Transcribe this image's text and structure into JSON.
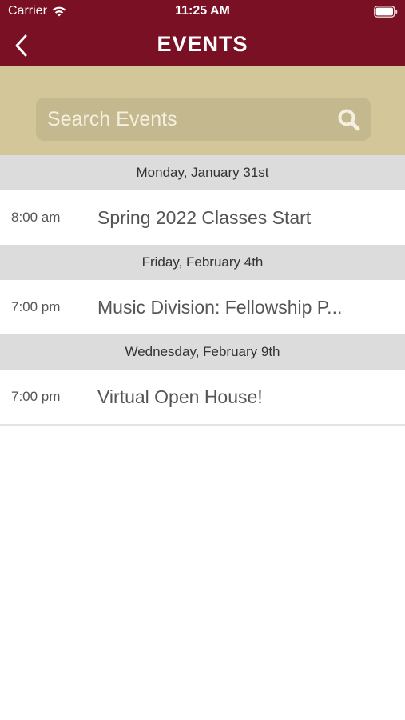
{
  "status_bar": {
    "carrier": "Carrier",
    "time": "11:25 AM"
  },
  "nav": {
    "title": "EVENTS",
    "back_icon": "chevron-left-icon"
  },
  "search": {
    "placeholder": "Search Events",
    "icon": "search-icon"
  },
  "colors": {
    "header_bg": "#7a1023",
    "search_area_bg": "#d3c799",
    "search_box_bg": "#c4b98e",
    "date_header_bg": "#dcdcdc"
  },
  "events": {
    "sections": [
      {
        "date": "Monday, January 31st",
        "items": [
          {
            "time": "8:00 am",
            "title": "Spring 2022 Classes Start"
          }
        ]
      },
      {
        "date": "Friday, February 4th",
        "items": [
          {
            "time": "7:00 pm",
            "title": "Music Division: Fellowship P..."
          }
        ]
      },
      {
        "date": "Wednesday, February 9th",
        "items": [
          {
            "time": "7:00 pm",
            "title": "Virtual Open House!"
          }
        ]
      }
    ]
  }
}
